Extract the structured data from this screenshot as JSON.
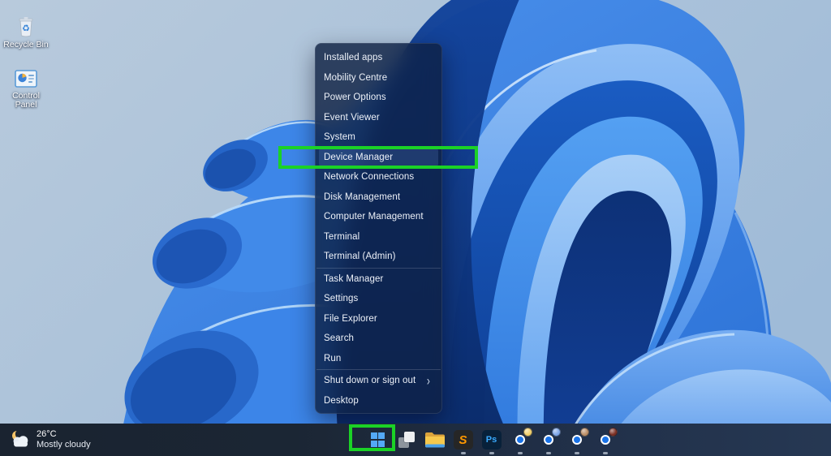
{
  "wallpaper": {
    "description": "Windows 11 blue bloom on light blue background",
    "background_color": "#aec5dc",
    "bloom_primary": "#3f87e8",
    "bloom_dark": "#0b2d70"
  },
  "desktop_icons": [
    {
      "label": "Recycle Bin"
    },
    {
      "label": "Control Panel"
    }
  ],
  "context_menu": {
    "submenu_arrow": "›",
    "items": [
      {
        "label": "Installed apps"
      },
      {
        "label": "Mobility Centre"
      },
      {
        "label": "Power Options"
      },
      {
        "label": "Event Viewer"
      },
      {
        "label": "System"
      },
      {
        "label": "Device Manager",
        "highlighted": true
      },
      {
        "label": "Network Connections"
      },
      {
        "label": "Disk Management"
      },
      {
        "label": "Computer Management"
      },
      {
        "label": "Terminal"
      },
      {
        "label": "Terminal (Admin)"
      },
      {
        "label": "Task Manager"
      },
      {
        "label": "Settings"
      },
      {
        "label": "File Explorer"
      },
      {
        "label": "Search"
      },
      {
        "label": "Run"
      },
      {
        "label": "Shut down or sign out",
        "has_submenu": true
      },
      {
        "label": "Desktop"
      }
    ]
  },
  "annotations": {
    "highlight_color": "#1bd226",
    "highlighted_menu_item": "Device Manager",
    "highlighted_taskbar_button": "Start"
  },
  "taskbar": {
    "weather": {
      "temperature": "26°C",
      "condition": "Mostly cloudy"
    },
    "apps": [
      {
        "name": "start"
      },
      {
        "name": "overlapping-squares-app"
      },
      {
        "name": "file-explorer"
      },
      {
        "name": "sublime-text",
        "glyph": "S",
        "running": true
      },
      {
        "name": "photoshop",
        "glyph": "Ps",
        "running": true
      },
      {
        "name": "chrome-profile-1",
        "running": true,
        "badge_color": "#f2cf6a"
      },
      {
        "name": "chrome-profile-2",
        "running": true,
        "badge_color": "#7ea6e8"
      },
      {
        "name": "chrome-profile-3",
        "running": true,
        "badge_color": "#bb8e66"
      },
      {
        "name": "chrome-profile-4",
        "running": true,
        "badge_color": "#7a2e22"
      }
    ]
  }
}
